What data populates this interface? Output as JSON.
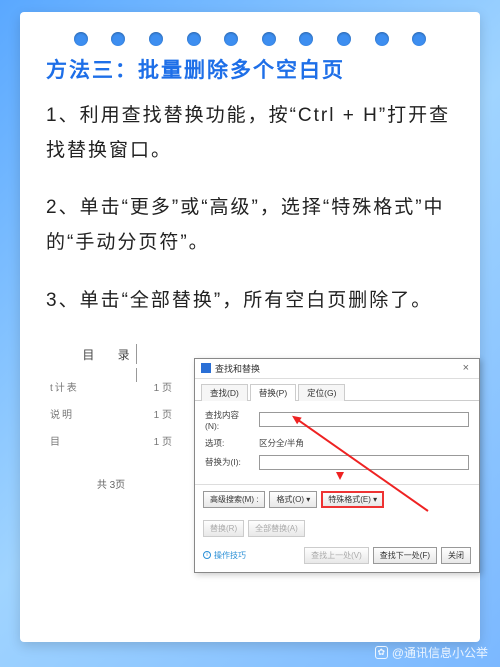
{
  "title": "方法三：批量删除多个空白页",
  "steps": [
    "1、利用查找替换功能，按“Ctrl + H”打开查找替换窗口。",
    "2、单击“更多”或“高级”，选择“特殊格式”中的“手动分页符”。",
    "3、单击“全部替换”，所有空白页删除了。"
  ],
  "doc": {
    "heading": "目  录",
    "rows": [
      {
        "label": "t计表",
        "page": "1 页"
      },
      {
        "label": "说明",
        "page": "1 页"
      },
      {
        "label": "目",
        "page": "1 页"
      }
    ],
    "total": "共  3页"
  },
  "dialog": {
    "title": "查找和替换",
    "tabs": [
      "查找(D)",
      "替换(P)",
      "定位(G)"
    ],
    "find_label": "查找内容(N):",
    "options_label": "选项:",
    "options_value": "区分全/半角",
    "replace_label": "替换为(I):",
    "buttons_top": {
      "more": "高级搜索(M) :",
      "format": "格式(O) ▾",
      "special": "特殊格式(E) ▾"
    },
    "buttons_mid": {
      "replace": "替换(R)",
      "replace_all": "全部替换(A)"
    },
    "tip": "操作技巧",
    "buttons_bot": {
      "find_prev": "查找上一处(V)",
      "find_next": "查找下一处(F)",
      "close": "关闭"
    }
  },
  "watermark": "@通讯信息小公举"
}
